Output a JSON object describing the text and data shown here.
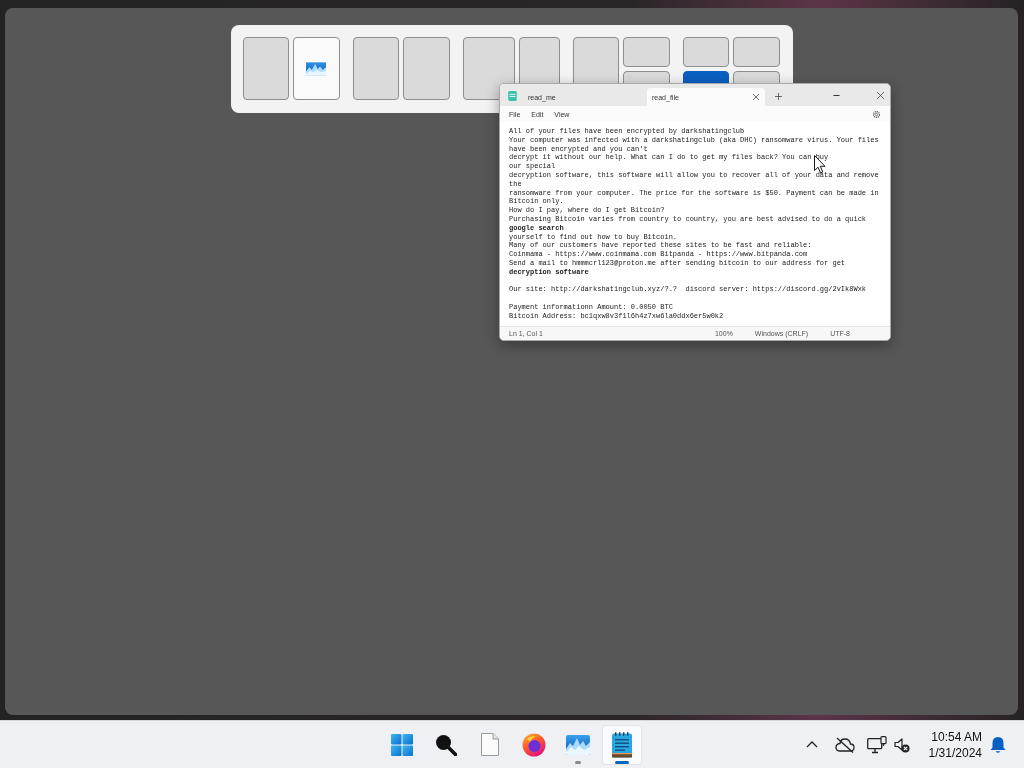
{
  "snap_layouts": [
    {
      "kind": "halves",
      "zones": [
        {
          "selected": false,
          "shows_app": false
        },
        {
          "selected": false,
          "shows_app": true
        }
      ]
    },
    {
      "kind": "halves",
      "zones": [
        {
          "selected": false,
          "shows_app": false
        },
        {
          "selected": false,
          "shows_app": false
        }
      ]
    },
    {
      "kind": "wide-narrow",
      "zones": [
        {
          "selected": false,
          "shows_app": false
        },
        {
          "selected": false,
          "shows_app": false
        }
      ]
    },
    {
      "kind": "main-stack",
      "zones": [
        {
          "selected": false,
          "shows_app": false
        },
        {
          "selected": false,
          "shows_app": false
        },
        {
          "selected": false,
          "shows_app": false
        }
      ]
    },
    {
      "kind": "quad",
      "zones": [
        {
          "selected": false,
          "shows_app": false
        },
        {
          "selected": false,
          "shows_app": false
        },
        {
          "selected": true,
          "shows_app": false
        },
        {
          "selected": false,
          "shows_app": false
        }
      ]
    }
  ],
  "notepad": {
    "tabs": [
      {
        "label": "read_me",
        "selected": false
      },
      {
        "label": "read_file",
        "selected": true
      }
    ],
    "menu": [
      "File",
      "Edit",
      "View"
    ],
    "paragraphs": [
      {
        "lines": [
          {
            "text": "All of your files have been encrypted by darkshatingclub",
            "bold": false
          },
          {
            "text": "Your computer was infected with a darkshatingclub (aka DHC) ransomware virus. Your files",
            "bold": false
          },
          {
            "text": "have been encrypted and you can't",
            "bold": false
          },
          {
            "text": "decrypt it without our help. What can I do to get my files back? You can buy",
            "bold": false
          },
          {
            "text": "our special",
            "bold": false
          },
          {
            "text": "decryption software, this software will allow you to recover all of your data and remove",
            "bold": false
          },
          {
            "text": "the",
            "bold": false
          },
          {
            "text": "ransomware from your computer. The price for the software is $50. Payment can be made in",
            "bold": false
          },
          {
            "text": "Bitcoin only.",
            "bold": false
          },
          {
            "text": "How do I pay, where do I get Bitcoin?",
            "bold": false
          },
          {
            "text": "Purchasing Bitcoin varies from country to country, you are best advised to do a quick",
            "bold": false
          },
          {
            "text": "google search",
            "bold": true
          },
          {
            "text": "yourself to find out how to buy Bitcoin.",
            "bold": false
          },
          {
            "text": "Many of our customers have reported these sites to be fast and reliable:",
            "bold": false
          },
          {
            "text": "Coinmama - https://www.coinmama.com Bitpanda - https://www.bitpanda.com",
            "bold": false
          },
          {
            "text": "Send a mail to hmmmcrl123@proton.me after sending bitcoin to our address for get",
            "bold": false
          },
          {
            "text": "decryption software",
            "bold": true
          }
        ]
      },
      {
        "lines": [
          {
            "text": "Our site: http://darkshatingclub.xyz/?.?  discord server: https://discord.gg/2vIk8Wxk",
            "bold": false
          }
        ]
      },
      {
        "lines": [
          {
            "text": "Payment informationn Amount: 0.0050 BTC",
            "bold": false
          },
          {
            "text": "Bitcoin Address: bc1qxw8v3f1l6h4z7xw6la0ddx6er5w0k2",
            "bold": false
          }
        ]
      }
    ],
    "status_bar": {
      "position": "Ln 1, Col 1",
      "zoom": "100%",
      "line_ending": "Windows (CRLF)",
      "encoding": "UTF-8"
    }
  },
  "taskbar": {
    "apps": [
      {
        "kind": "start",
        "running": false,
        "selected": false
      },
      {
        "kind": "search",
        "running": false,
        "selected": false
      },
      {
        "kind": "document",
        "running": false,
        "selected": false
      },
      {
        "kind": "browser",
        "running": false,
        "selected": false
      },
      {
        "kind": "image",
        "running": true,
        "selected": false
      },
      {
        "kind": "notepad",
        "running": true,
        "selected": true
      }
    ],
    "clock": {
      "time": "10:54 AM",
      "date": "1/31/2024"
    }
  }
}
